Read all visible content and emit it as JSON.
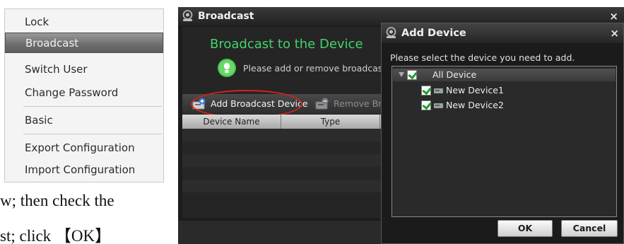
{
  "context_menu": {
    "items": [
      {
        "label": "Lock"
      },
      {
        "label": "Broadcast",
        "selected": true
      },
      {
        "label": "Switch User"
      },
      {
        "label": "Change Password"
      },
      {
        "label": "Basic"
      },
      {
        "label": "Export Configuration"
      },
      {
        "label": "Import Configuration"
      }
    ]
  },
  "body_text": {
    "line1": "w; then check the",
    "line2": "st; click 【OK】"
  },
  "broadcast_window": {
    "title": "Broadcast",
    "close_glyph": "×",
    "heading": "Broadcast to the Device",
    "hint": "Please add or remove broadcast",
    "toolbar": {
      "add_label": "Add Broadcast Device",
      "remove_label": "Remove Broa"
    },
    "table": {
      "columns": [
        "Device Name",
        "Type"
      ]
    }
  },
  "add_device_dialog": {
    "title": "Add Device",
    "close_glyph": "×",
    "prompt": "Please select the device you need to add.",
    "tree": {
      "root": {
        "label": "All Device",
        "checked": true
      },
      "children": [
        {
          "label": "New Device1",
          "checked": true
        },
        {
          "label": "New Device2",
          "checked": true
        }
      ]
    },
    "ok_label": "OK",
    "cancel_label": "Cancel"
  },
  "colors": {
    "accent_green": "#44d36a",
    "highlight_red": "#d4231f",
    "selected_menu": "#6d6d6d"
  }
}
